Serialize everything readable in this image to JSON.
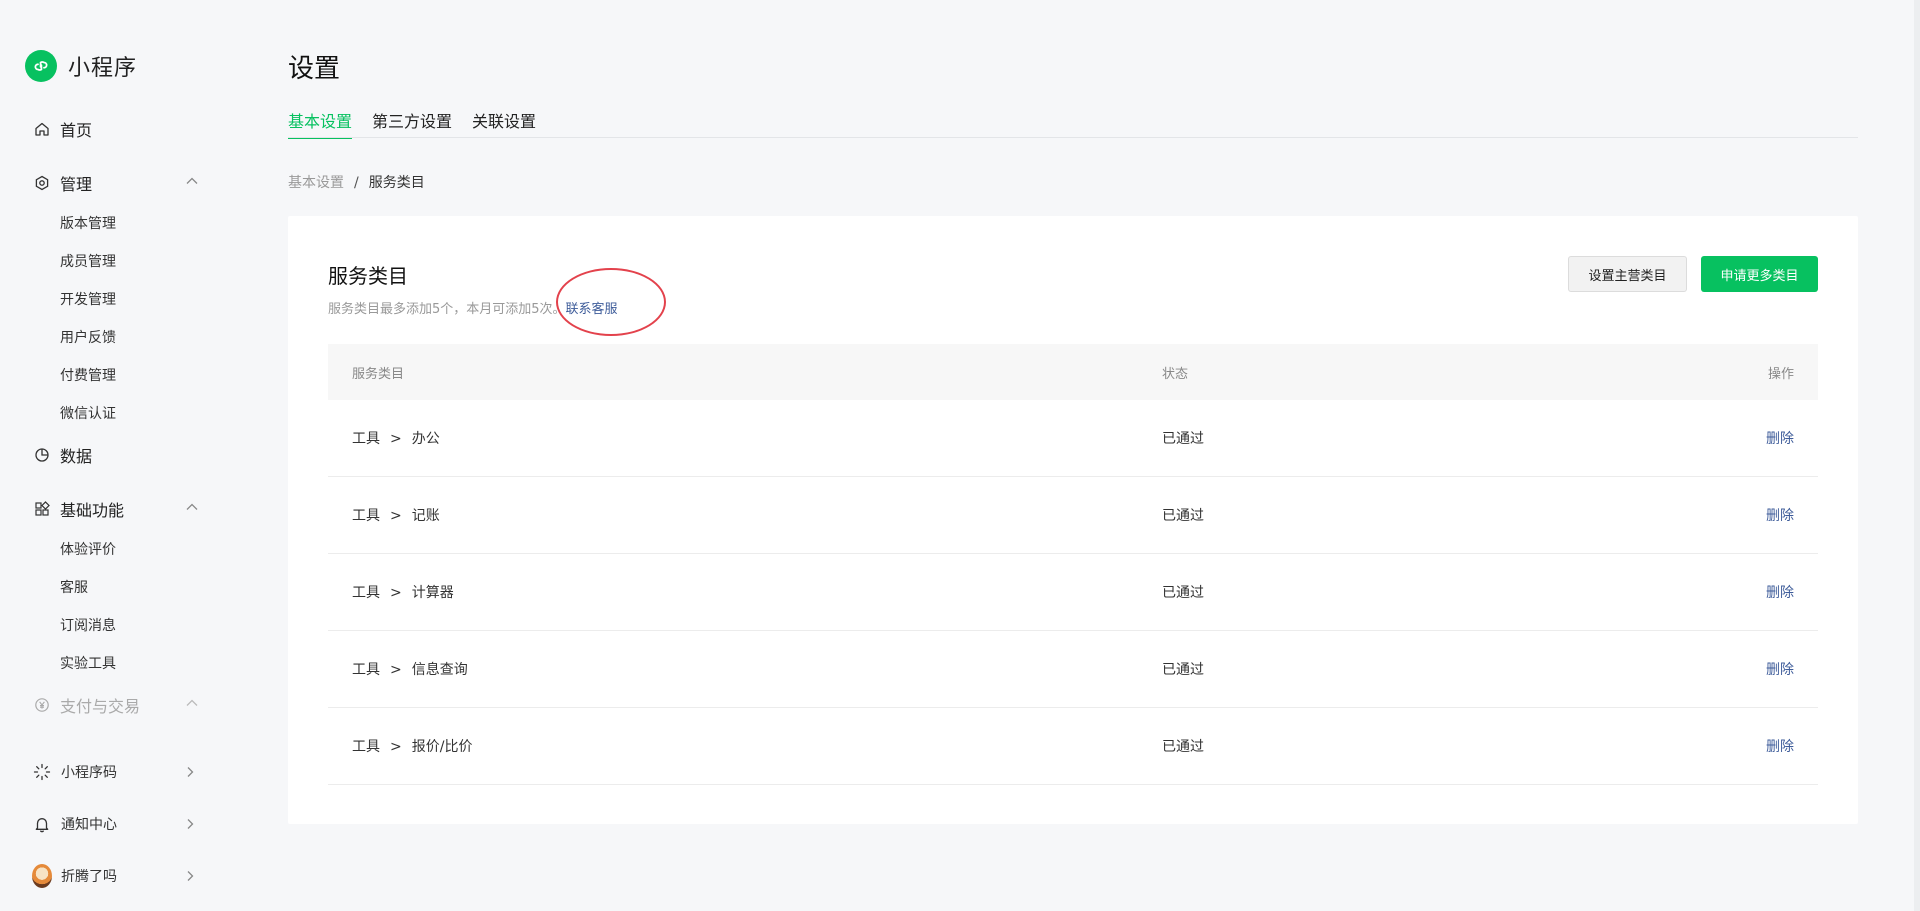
{
  "app": {
    "name": "小程序"
  },
  "sidebar": {
    "home": "首页",
    "manage": {
      "label": "管理",
      "items": [
        "版本管理",
        "成员管理",
        "开发管理",
        "用户反馈",
        "付费管理",
        "微信认证"
      ]
    },
    "data": "数据",
    "basic": {
      "label": "基础功能",
      "items": [
        "体验评价",
        "客服",
        "订阅消息",
        "实验工具"
      ]
    },
    "payment": "支付与交易",
    "bottom": [
      {
        "label": "小程序码",
        "icon": "qrcode-sun-icon"
      },
      {
        "label": "通知中心",
        "icon": "bell-icon"
      },
      {
        "label": "折腾了吗",
        "icon": "avatar"
      }
    ]
  },
  "page": {
    "title": "设置",
    "tabs": [
      "基本设置",
      "第三方设置",
      "关联设置"
    ],
    "breadcrumb": {
      "parent": "基本设置",
      "separator": "/",
      "current": "服务类目"
    }
  },
  "card": {
    "title": "服务类目",
    "desc": "服务类目最多添加5个，本月可添加5次。",
    "desc_link": "联系客服",
    "btn_set_main": "设置主营类目",
    "btn_apply_more": "申请更多类目",
    "columns": {
      "category": "服务类目",
      "status": "状态",
      "action": "操作"
    },
    "rows": [
      {
        "parent": "工具",
        "sep": ">",
        "child": "办公",
        "status": "已通过",
        "action": "删除"
      },
      {
        "parent": "工具",
        "sep": ">",
        "child": "记账",
        "status": "已通过",
        "action": "删除"
      },
      {
        "parent": "工具",
        "sep": ">",
        "child": "计算器",
        "status": "已通过",
        "action": "删除"
      },
      {
        "parent": "工具",
        "sep": ">",
        "child": "信息查询",
        "status": "已通过",
        "action": "删除"
      },
      {
        "parent": "工具",
        "sep": ">",
        "child": "报价/比价",
        "status": "已通过",
        "action": "删除"
      }
    ]
  },
  "colors": {
    "accent": "#07c160",
    "link": "#3e5c9a",
    "highlight": "#e3424c"
  }
}
